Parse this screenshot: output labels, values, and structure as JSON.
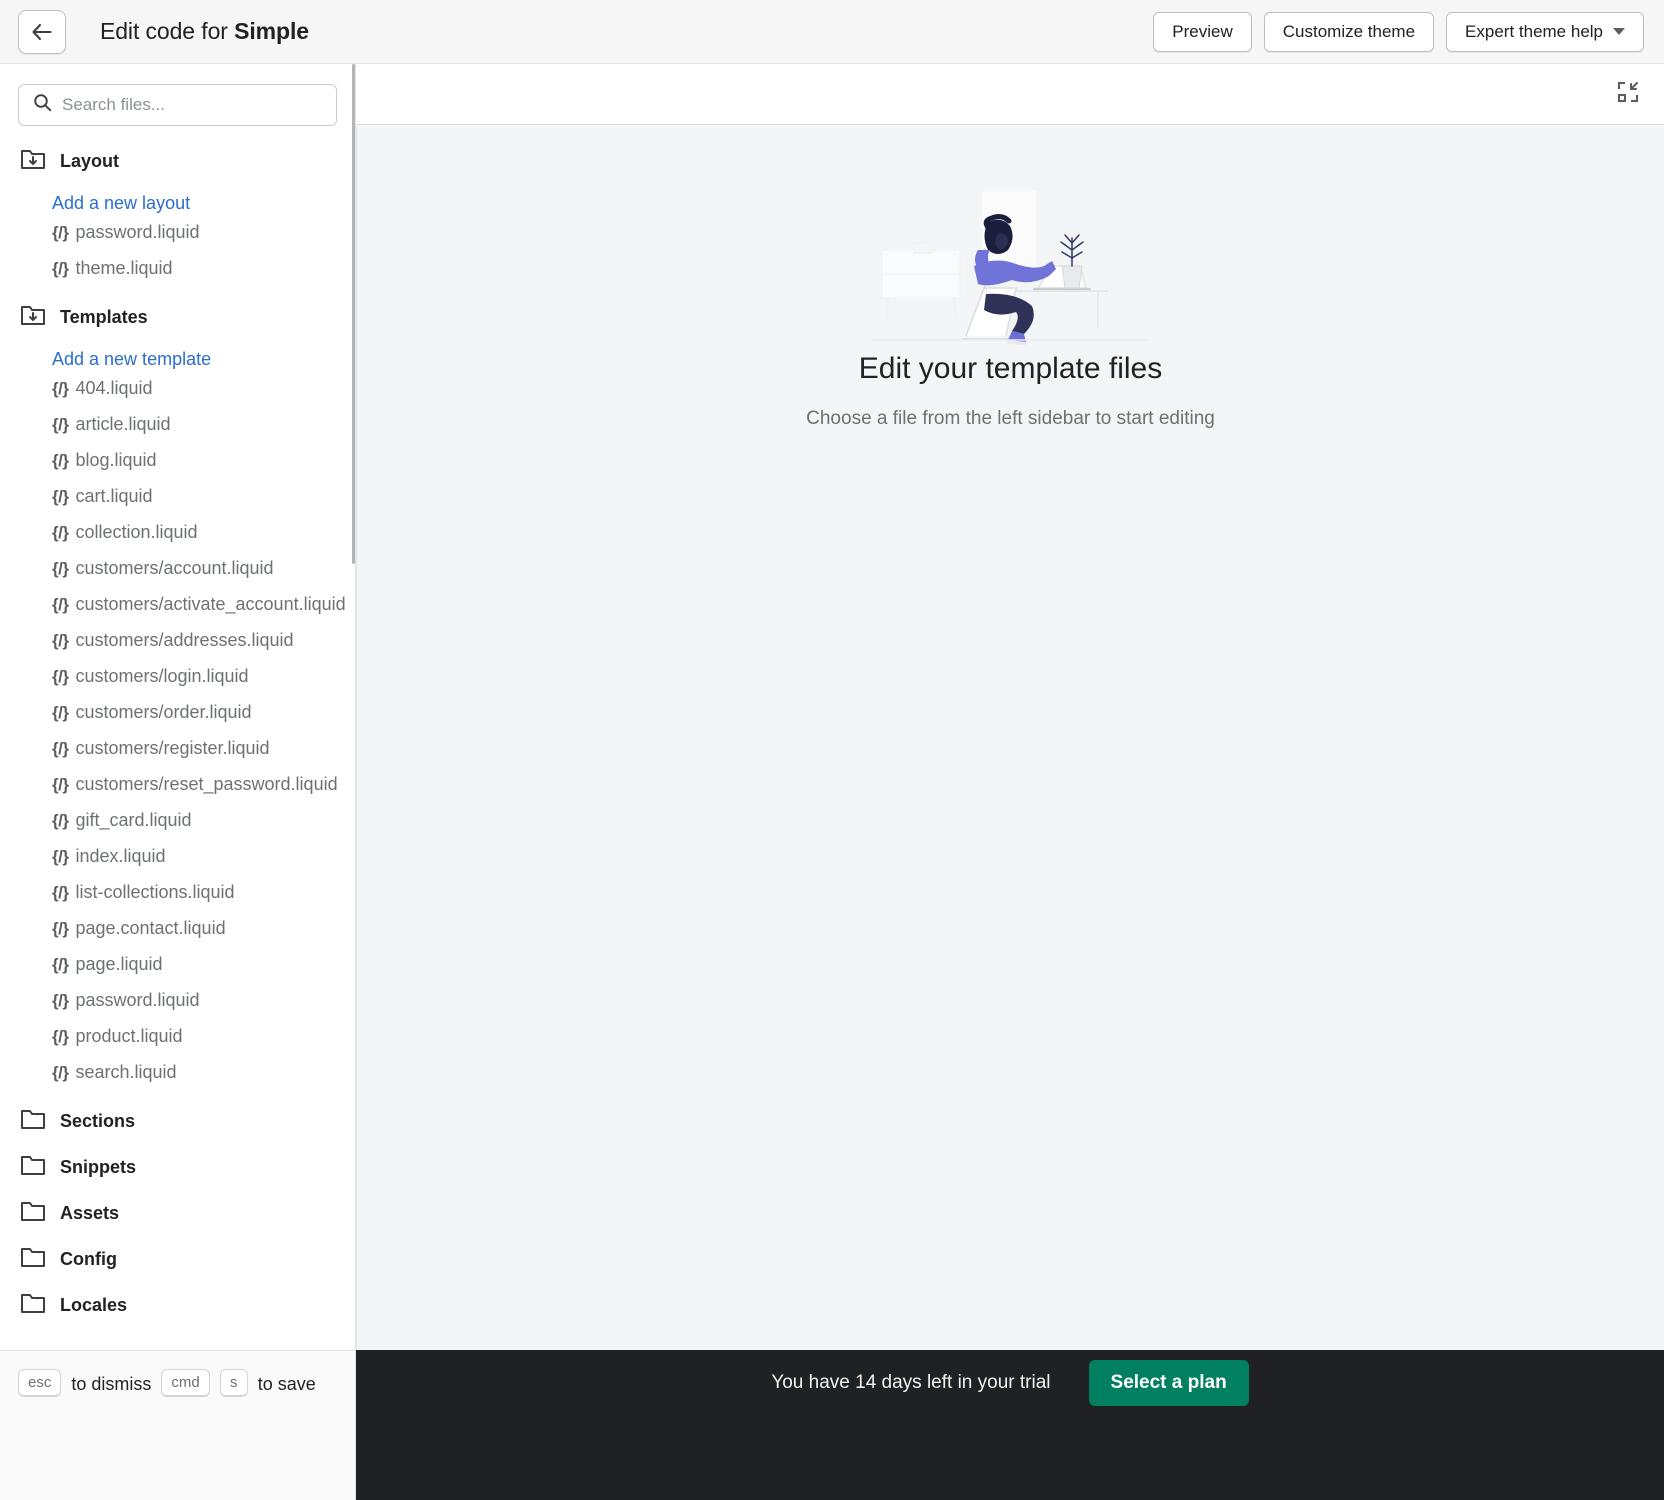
{
  "topbar": {
    "back_icon": "arrow-left-icon",
    "title_prefix": "Edit code for ",
    "title_theme": "Simple",
    "preview_label": "Preview",
    "customize_label": "Customize theme",
    "expert_label": "Expert theme help"
  },
  "search": {
    "placeholder": "Search files...",
    "value": "",
    "icon": "search-icon"
  },
  "tree": [
    {
      "type": "folder",
      "label": "Layout",
      "expanded": true,
      "icon": "folder-open-icon",
      "add_link": "Add a new layout",
      "files": [
        "password.liquid",
        "theme.liquid"
      ]
    },
    {
      "type": "folder",
      "label": "Templates",
      "expanded": true,
      "icon": "folder-open-icon",
      "add_link": "Add a new template",
      "files": [
        "404.liquid",
        "article.liquid",
        "blog.liquid",
        "cart.liquid",
        "collection.liquid",
        "customers/account.liquid",
        "customers/activate_account.liquid",
        "customers/addresses.liquid",
        "customers/login.liquid",
        "customers/order.liquid",
        "customers/register.liquid",
        "customers/reset_password.liquid",
        "gift_card.liquid",
        "index.liquid",
        "list-collections.liquid",
        "page.contact.liquid",
        "page.liquid",
        "password.liquid",
        "product.liquid",
        "search.liquid"
      ]
    },
    {
      "type": "folder",
      "label": "Sections",
      "expanded": false,
      "icon": "folder-icon",
      "add_link": null,
      "files": []
    },
    {
      "type": "folder",
      "label": "Snippets",
      "expanded": false,
      "icon": "folder-icon",
      "add_link": null,
      "files": []
    },
    {
      "type": "folder",
      "label": "Assets",
      "expanded": false,
      "icon": "folder-icon",
      "add_link": null,
      "files": []
    },
    {
      "type": "folder",
      "label": "Config",
      "expanded": false,
      "icon": "folder-icon",
      "add_link": null,
      "files": []
    },
    {
      "type": "folder",
      "label": "Locales",
      "expanded": false,
      "icon": "folder-icon",
      "add_link": null,
      "files": []
    }
  ],
  "file_icon_glyph": "{/}",
  "shortcuts": {
    "esc_key": "esc",
    "esc_text": "to dismiss",
    "cmd_key": "cmd",
    "s_key": "s",
    "save_text": "to save"
  },
  "main": {
    "collapse_icon": "collapse-inward-icon",
    "empty_title": "Edit your template files",
    "empty_subtitle": "Choose a file from the left sidebar to start editing",
    "illustration": "person-at-desk-with-laptop-illustration"
  },
  "trial": {
    "text": "You have 14 days left in your trial",
    "button_label": "Select a plan",
    "button_color": "#008060",
    "bar_color": "#202123"
  }
}
